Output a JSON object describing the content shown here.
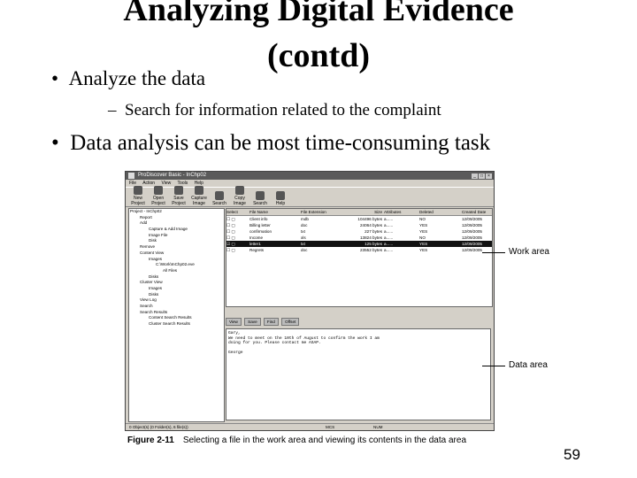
{
  "slide": {
    "title_line1": "Analyzing Digital Evidence",
    "title_line2": "(contd)",
    "bullet1": "Analyze the data",
    "sub1": "Search for information related to the complaint",
    "bullet2": "Data analysis can be most time-consuming task",
    "page_number": "59"
  },
  "figure": {
    "label": "Figure 2-11",
    "text": "Selecting a file in the work area and viewing its contents in the data area",
    "callout_work": "Work area",
    "callout_data": "Data area"
  },
  "app": {
    "title": "ProDiscover Basic - InChp02",
    "menu": [
      "File",
      "Action",
      "View",
      "Tools",
      "Help"
    ],
    "toolbar": [
      "New Project",
      "Open Project",
      "Save Project",
      "Capture Image",
      "Search",
      "Copy Image",
      "Search",
      "Help"
    ],
    "tree": [
      "Project - InChp02",
      "Report",
      "Add",
      "Capture & Add Image",
      "Image File",
      "Disk",
      "Remove",
      "Content View",
      "Images",
      "C:\\Work\\InChp02.eve",
      "All Files",
      "Disks",
      "Cluster View",
      "Images",
      "Disks",
      "View Log",
      "Search",
      "Search Results",
      "Content Search Results",
      "Cluster Search Results"
    ],
    "columns": [
      "Select",
      "File Name",
      "File Extension",
      "Size",
      "Attributes",
      "Deleted",
      "Created Date"
    ],
    "rows": [
      [
        "",
        "Client info",
        "mdb",
        "104496 bytes",
        "a......",
        "NO",
        "12/09/2005"
      ],
      [
        "",
        "Billing letter",
        "doc",
        "24064 bytes",
        "a......",
        "YES",
        "12/09/2005"
      ],
      [
        "",
        "confirmation",
        "txt",
        "227 bytes",
        "a......",
        "YES",
        "12/09/2005"
      ],
      [
        "",
        "Income",
        "xls",
        "13824 bytes",
        "a......",
        "NO",
        "12/09/2005"
      ],
      [
        "",
        "letter1",
        "txt",
        "125 bytes",
        "a......",
        "YES",
        "12/09/2005"
      ],
      [
        "",
        "Regrets",
        "doc",
        "23552 bytes",
        "a......",
        "YES",
        "12/09/2005"
      ]
    ],
    "data_buttons": [
      "View",
      "Save",
      "Find",
      "Offset"
    ],
    "data_text": [
      "Gary,",
      "We need to meet on the 10th of August to confirm the work I am",
      "doing for you. Please contact me ASAP.",
      "",
      "George"
    ],
    "status_left": "0 Object(s) (0 Folder(s), 6 file(s))",
    "status_mid": "MCS",
    "status_right": "NUM"
  }
}
